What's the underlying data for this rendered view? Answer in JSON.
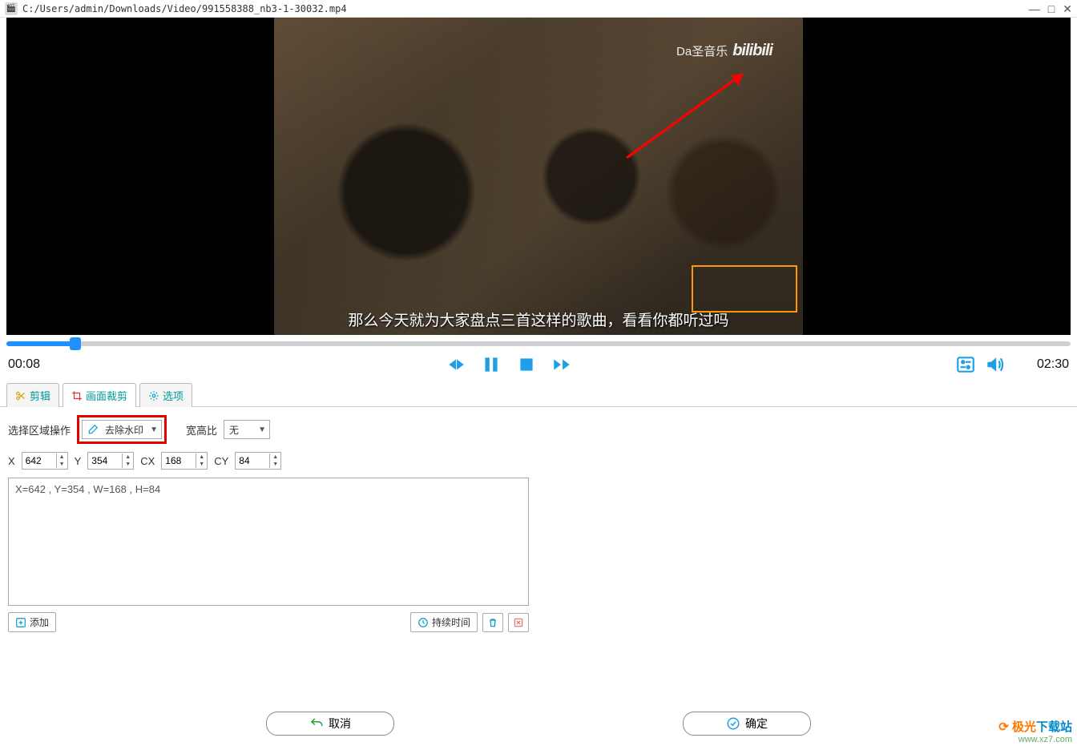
{
  "window": {
    "title": "C:/Users/admin/Downloads/Video/991558388_nb3-1-30032.mp4"
  },
  "video": {
    "watermark_text": "Da圣音乐",
    "watermark_logo": "bilibili",
    "subtitle": "那么今天就为大家盘点三首这样的歌曲，看看你都听过吗",
    "selection": {
      "x_pct": 79,
      "y_pct": 78,
      "w_pct": 20,
      "h_pct": 15
    }
  },
  "playback": {
    "current_time": "00:08",
    "total_time": "02:30"
  },
  "tabs": {
    "edit": "剪辑",
    "crop": "画面裁剪",
    "options": "选项"
  },
  "crop_panel": {
    "region_op_label": "选择区域操作",
    "region_op_value": "去除水印",
    "aspect_label": "宽高比",
    "aspect_value": "无",
    "x_label": "X",
    "x_value": "642",
    "y_label": "Y",
    "y_value": "354",
    "cx_label": "CX",
    "cx_value": "168",
    "cy_label": "CY",
    "cy_value": "84",
    "list_entry": "X=642 , Y=354 , W=168 , H=84",
    "add_btn": "添加",
    "duration_btn": "持续时间"
  },
  "footer": {
    "cancel": "取消",
    "ok": "确定"
  },
  "site_logo": {
    "line1a": "极光",
    "line1b": "下载站",
    "line2": "www.xz7.com"
  }
}
